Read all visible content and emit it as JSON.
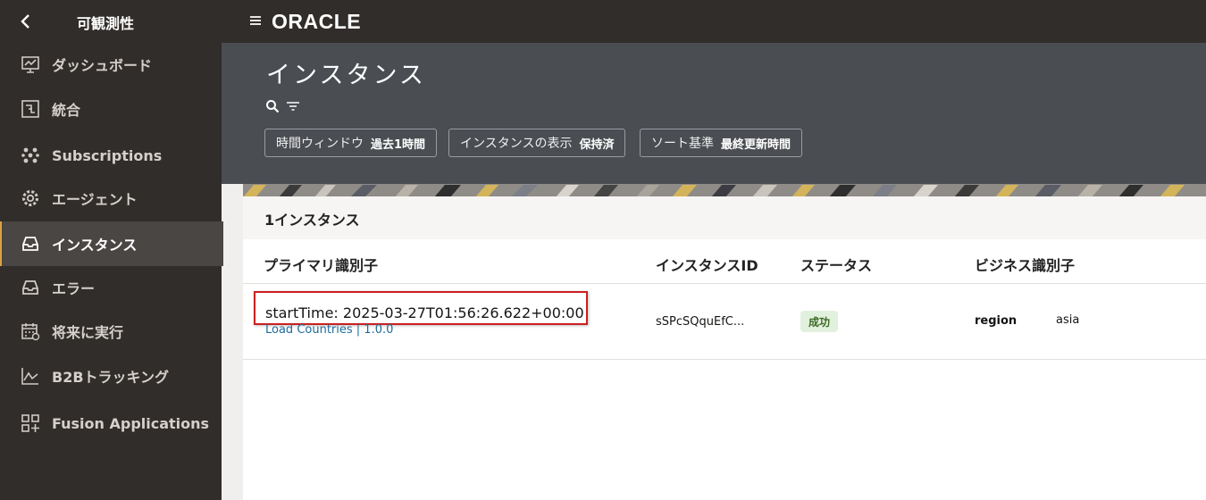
{
  "sidebar": {
    "title": "可観測性",
    "items": [
      {
        "label": "ダッシュボード",
        "icon": "dashboard-icon"
      },
      {
        "label": "統合",
        "icon": "integration-icon"
      },
      {
        "label": "Subscriptions",
        "icon": "subscriptions-icon"
      },
      {
        "label": "エージェント",
        "icon": "agent-gear-icon"
      },
      {
        "label": "インスタンス",
        "icon": "inbox-icon",
        "active": true
      },
      {
        "label": "エラー",
        "icon": "inbox-icon"
      },
      {
        "label": "将来に実行",
        "icon": "calendar-icon"
      },
      {
        "label": "B2Bトラッキング",
        "icon": "line-chart-icon"
      },
      {
        "label": "Fusion Applications",
        "icon": "apps-grid-icon"
      }
    ]
  },
  "topbar": {
    "logo": "ORACLE"
  },
  "header": {
    "title": "インスタンス",
    "filters": [
      {
        "label": "時間ウィンドウ",
        "value": "過去1時間"
      },
      {
        "label": "インスタンスの表示",
        "value": "保持済"
      },
      {
        "label": "ソート基準",
        "value": "最終更新時間"
      }
    ]
  },
  "content": {
    "count_label": "1インスタンス",
    "columns": [
      "プライマリ識別子",
      "インスタンスID",
      "ステータス",
      "ビジネス識別子"
    ],
    "rows": [
      {
        "primary_id": "startTime: 2025-03-27T01:56:26.622+00:00",
        "integration_link": "Load Countries | 1.0.0",
        "instance_id": "sSPcSQquEfC...",
        "status": "成功",
        "business_key": "region",
        "business_value": "asia"
      }
    ]
  },
  "colors": {
    "sidebar_bg": "#312d2a",
    "header_bg": "#4a4d52",
    "active_accent": "#d9a33f",
    "highlight_border": "#cc1f1f",
    "success_bg": "#e2f1dd",
    "link": "#1f6b9c"
  }
}
